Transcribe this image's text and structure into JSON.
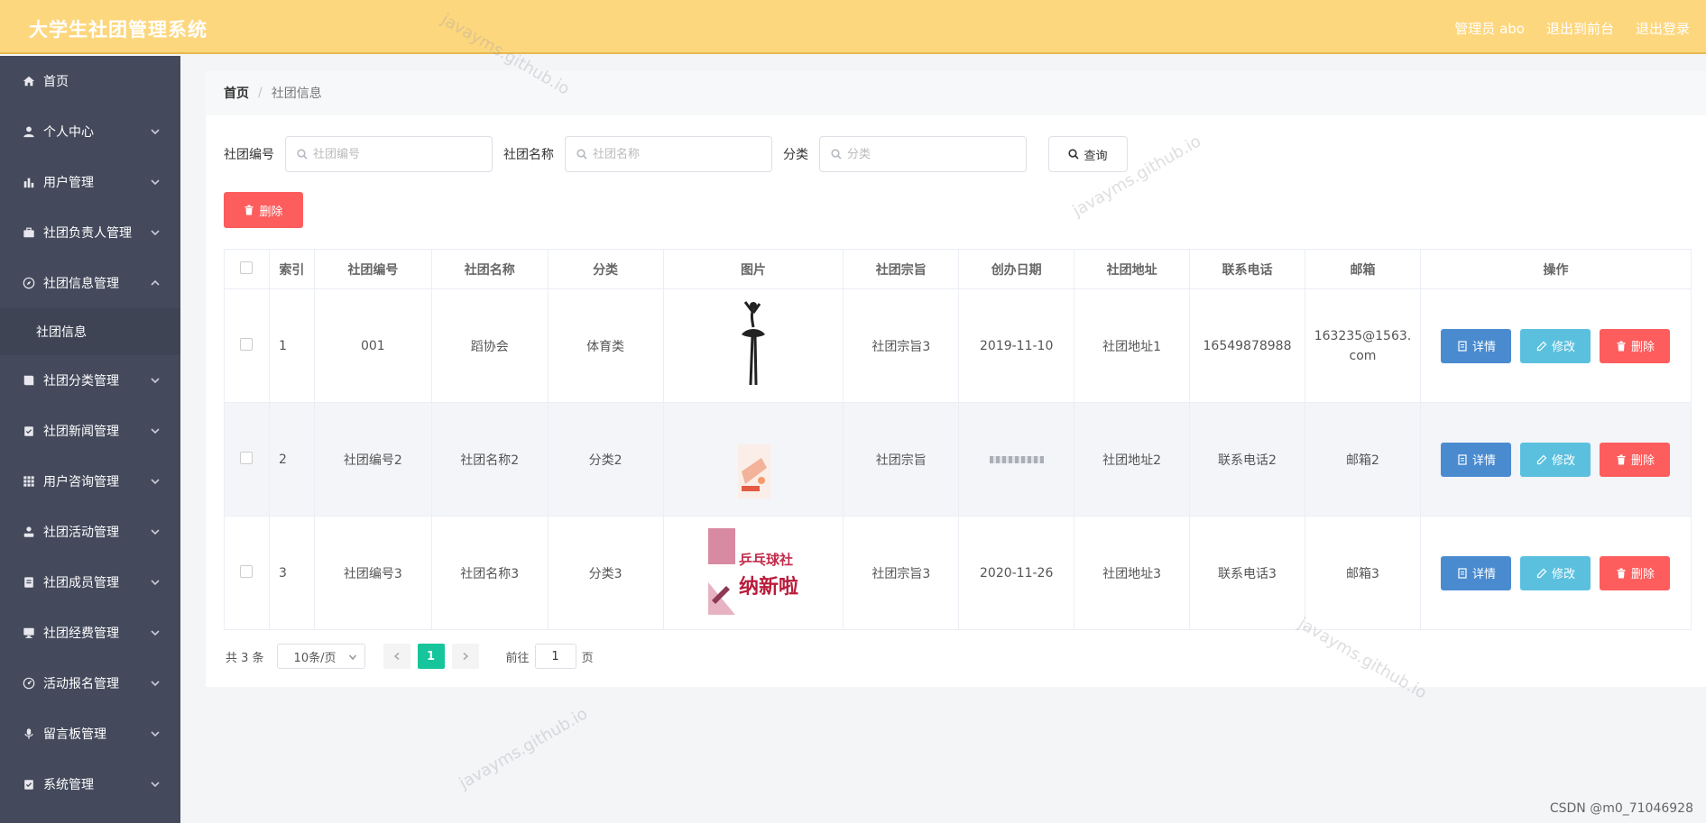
{
  "header": {
    "title": "大学生社团管理系统",
    "user": "管理员 abo",
    "to_front": "退出到前台",
    "logout": "退出登录"
  },
  "sidebar": {
    "items": [
      {
        "label": "首页",
        "icon": "home-icon",
        "chevron": false
      },
      {
        "label": "个人中心",
        "icon": "user-icon",
        "chevron": true
      },
      {
        "label": "用户管理",
        "icon": "bar-chart-icon",
        "chevron": true
      },
      {
        "label": "社团负责人管理",
        "icon": "briefcase-icon",
        "chevron": true
      },
      {
        "label": "社团信息管理",
        "icon": "compass-icon",
        "chevron": true,
        "expanded": true
      },
      {
        "label": "社团分类管理",
        "icon": "book-icon",
        "chevron": true
      },
      {
        "label": "社团新闻管理",
        "icon": "clipboard-check-icon",
        "chevron": true
      },
      {
        "label": "用户咨询管理",
        "icon": "grid-icon",
        "chevron": true
      },
      {
        "label": "社团活动管理",
        "icon": "person-icon",
        "chevron": true
      },
      {
        "label": "社团成员管理",
        "icon": "document-icon",
        "chevron": true
      },
      {
        "label": "社团经费管理",
        "icon": "monitor-icon",
        "chevron": true
      },
      {
        "label": "活动报名管理",
        "icon": "dashboard-icon",
        "chevron": true
      },
      {
        "label": "留言板管理",
        "icon": "mic-icon",
        "chevron": true
      },
      {
        "label": "系统管理",
        "icon": "settings-icon",
        "chevron": true
      }
    ],
    "sub_item": "社团信息"
  },
  "breadcrumb": {
    "home": "首页",
    "separator": "/",
    "current": "社团信息"
  },
  "search": {
    "label_code": "社团编号",
    "placeholder_code": "社团编号",
    "label_name": "社团名称",
    "placeholder_name": "社团名称",
    "label_category": "分类",
    "placeholder_category": "分类",
    "query_label": "查询"
  },
  "delete_label": "删除",
  "table": {
    "headers": [
      "索引",
      "社团编号",
      "社团名称",
      "分类",
      "图片",
      "社团宗旨",
      "创办日期",
      "社团地址",
      "联系电话",
      "邮箱",
      "操作"
    ],
    "rows": [
      {
        "index": "1",
        "code": "001",
        "name": "蹈协会",
        "category": "体育类",
        "purpose": "社团宗旨3",
        "date": "2019-11-10",
        "address": "社团地址1",
        "phone": "16549878988",
        "email": "163235@1563.com"
      },
      {
        "index": "2",
        "code": "社团编号2",
        "name": "社团名称2",
        "category": "分类2",
        "purpose": "社团宗旨",
        "date": "",
        "address": "社团地址2",
        "phone": "联系电话2",
        "email": "邮箱2"
      },
      {
        "index": "3",
        "code": "社团编号3",
        "name": "社团名称3",
        "category": "分类3",
        "purpose": "社团宗旨3",
        "date": "2020-11-26",
        "address": "社团地址3",
        "phone": "联系电话3",
        "email": "邮箱3"
      }
    ],
    "actions": {
      "detail": "详情",
      "edit": "修改",
      "delete": "删除"
    }
  },
  "pagination": {
    "total": "共 3 条",
    "page_size": "10条/页",
    "current_page": "1",
    "goto_label": "前往",
    "goto_value": "1",
    "page_suffix": "页"
  },
  "poster_text": {
    "line1": "乒乓球社",
    "line2": "纳新啦!"
  },
  "watermark": "javayms.github.io",
  "footer_mark": "CSDN @m0_71046928",
  "colors": {
    "header": "#fdd77e",
    "sidebar": "#444a5c",
    "detail": "#4a8bd0",
    "edit": "#5bc0de",
    "delete": "#fd5d5d",
    "page_active": "#16c59b"
  }
}
